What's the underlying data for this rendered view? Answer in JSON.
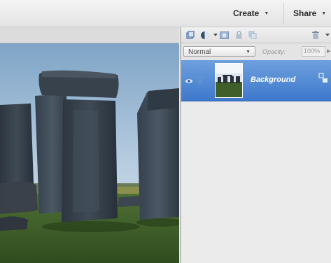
{
  "topbar": {
    "create_label": "Create",
    "share_label": "Share"
  },
  "layers_panel": {
    "blend_mode": "Normal",
    "opacity_label": "Opacity:",
    "opacity_value": "100%",
    "layers": [
      {
        "name": "Background",
        "visible": true,
        "selected": true
      }
    ]
  },
  "icons": {
    "toolbar": [
      "new-layer-icon",
      "adjustment-layer-icon",
      "mask-icon",
      "lock-icon",
      "lock-transparency-icon",
      "trash-icon",
      "panel-menu-icon"
    ],
    "layer_row": [
      "eye-icon",
      "link-icon",
      "layer-thumbnail",
      "layer-style-icon"
    ]
  },
  "colors": {
    "selection": "#4a83d4",
    "panel_bg": "#ebebeb",
    "topbar_bg": "#eeeeee"
  }
}
